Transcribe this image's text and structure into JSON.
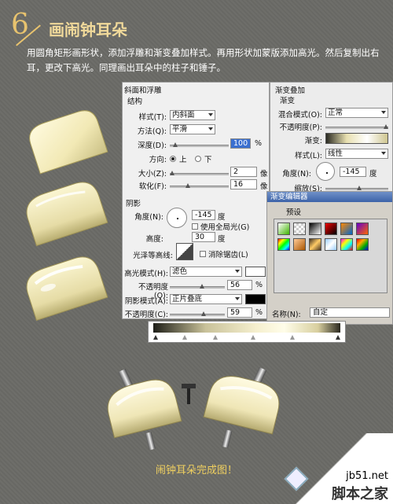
{
  "header": {
    "step_number": "6",
    "title": "画闹钟耳朵"
  },
  "description": "用圆角矩形画形状，添加浮雕和渐变叠加样式。再用形状加蒙版添加高光。然后复制出右耳，更改下高光。同理画出耳朵中的柱子和锤子。",
  "bevel_panel": {
    "header": "斜面和浮雕",
    "section": "结构",
    "style_label": "样式(T):",
    "style_value": "内斜面",
    "technique_label": "方法(Q):",
    "technique_value": "平滑",
    "depth_label": "深度(D):",
    "depth_value": "100",
    "depth_unit": "%",
    "direction_label": "方向:",
    "dir_up": "上",
    "dir_down": "下",
    "size_label": "大小(Z):",
    "size_value": "2",
    "size_unit": "像",
    "soften_label": "软化(F):",
    "soften_value": "16",
    "soften_unit": "像",
    "shading_section": "阴影",
    "angle_label": "角度(N):",
    "angle_value": "-145",
    "angle_unit": "度",
    "global_light_label": "使用全局光(G)",
    "altitude_label": "高度:",
    "altitude_value": "30",
    "altitude_unit": "度",
    "gloss_label": "光泽等高线:",
    "antialias_label": "消除锯齿(L)",
    "highlight_mode_label": "高光模式(H):",
    "highlight_mode_value": "滤色",
    "highlight_opacity_label": "不透明度(O):",
    "highlight_opacity_value": "56",
    "highlight_opacity_unit": "%",
    "shadow_mode_label": "阴影模式(A):",
    "shadow_mode_value": "正片叠底",
    "shadow_opacity_label": "不透明度(C):",
    "shadow_opacity_value": "59",
    "shadow_opacity_unit": "%",
    "highlight_color": "#ffffff",
    "shadow_color": "#000000"
  },
  "gradient_panel": {
    "header": "渐变叠加",
    "section": "渐变",
    "blend_label": "混合模式(O):",
    "blend_value": "正常",
    "opacity_label": "不透明度(P):",
    "gradient_label": "渐变:",
    "style_label": "样式(L):",
    "style_value": "线性",
    "angle_label": "角度(N):",
    "angle_value": "-145",
    "angle_unit": "度",
    "scale_label": "缩放(S):"
  },
  "gradient_editor": {
    "title": "渐变编辑器",
    "presets_label": "预设",
    "name_label": "名称(N):",
    "name_value": "自定"
  },
  "caption": "闹钟耳朵完成图！",
  "watermark": {
    "url": "jb51.net",
    "site": "脚本之家"
  },
  "colors": {
    "background": "#6b6b66",
    "accent": "#e8c36e",
    "ear": "#f2edc4",
    "caption": "#f0d060"
  }
}
